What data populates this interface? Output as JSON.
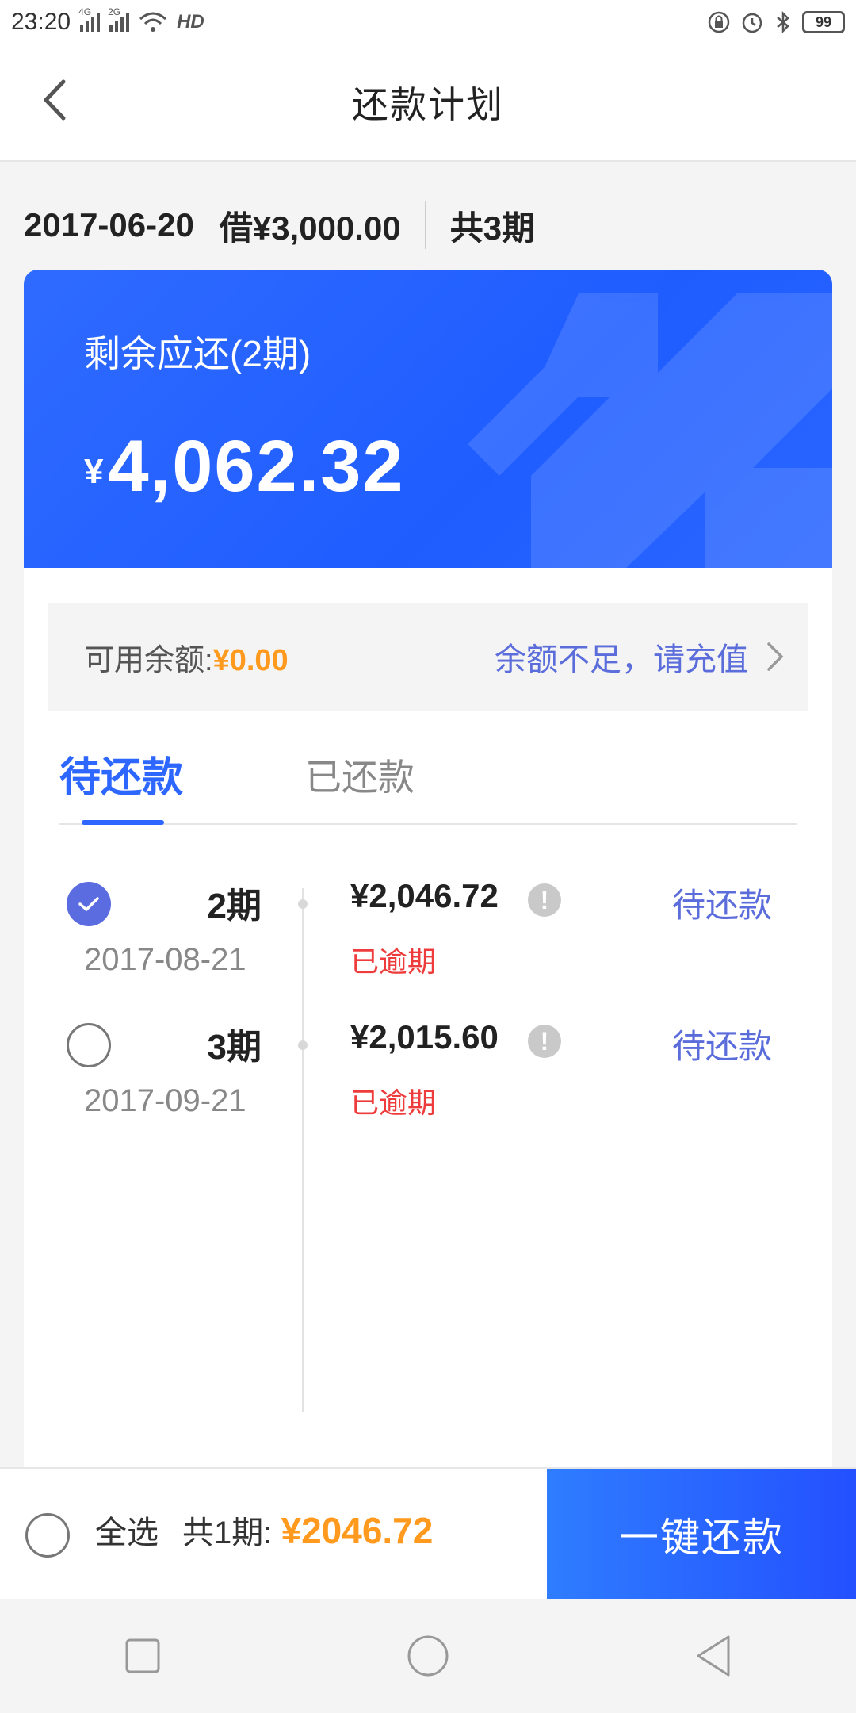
{
  "status_bar": {
    "time": "23:20",
    "signal1": "4G",
    "signal2": "2G",
    "hd": "HD",
    "battery": "99",
    "icons": [
      "lock-icon",
      "alarm-icon",
      "bluetooth-icon",
      "battery-icon"
    ]
  },
  "nav": {
    "title": "还款计划"
  },
  "loan": {
    "date": "2017-06-20",
    "amount": "借¥3,000.00",
    "terms": "共3期"
  },
  "hero": {
    "label": "剩余应还(2期)",
    "currency": "¥",
    "amount": "4,062.32"
  },
  "balance": {
    "label": "可用余额:",
    "value": "¥0.00",
    "recharge_text": "余额不足，请充值"
  },
  "tabs": {
    "pending": "待还款",
    "paid": "已还款"
  },
  "installments": [
    {
      "period": "2期",
      "date": "2017-08-21",
      "amount": "¥2,046.72",
      "overdue": "已逾期",
      "status": "待还款",
      "checked": true
    },
    {
      "period": "3期",
      "date": "2017-09-21",
      "amount": "¥2,015.60",
      "overdue": "已逾期",
      "status": "待还款",
      "checked": false
    }
  ],
  "bottom": {
    "select_all": "全选",
    "count": "共1期:",
    "total": "¥2046.72",
    "pay_button": "一键还款"
  },
  "colors": {
    "accent_blue": "#2e67ff",
    "orange": "#ff9a1f",
    "overdue_red": "#ee3b3b",
    "link_purple": "#5b6cdb"
  }
}
